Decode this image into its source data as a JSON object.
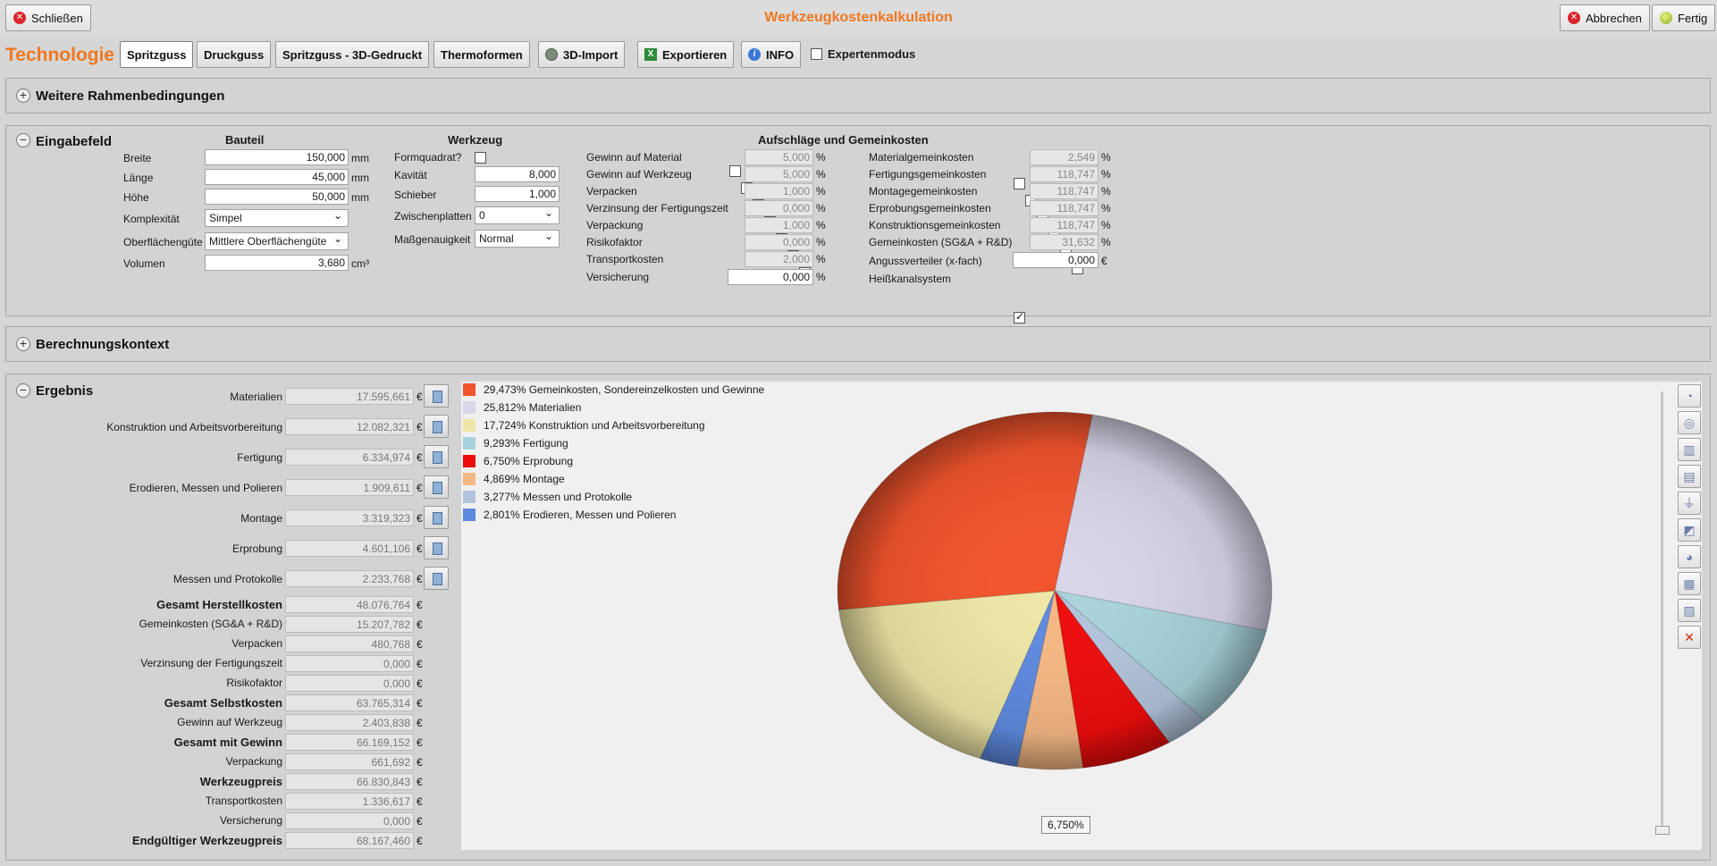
{
  "window": {
    "title": "Werkzeugkostenkalkulation",
    "close_label": "Schließen",
    "cancel_label": "Abbrechen",
    "done_label": "Fertig"
  },
  "toolbar": {
    "technology_label": "Technologie",
    "tabs": [
      "Spritzguss",
      "Druckguss",
      "Spritzguss - 3D-Gedruckt",
      "Thermoformen"
    ],
    "import_label": "3D-Import",
    "export_label": "Exportieren",
    "info_label": "INFO",
    "expert_label": "Expertenmodus"
  },
  "panels": {
    "rahmen": "Weitere Rahmenbedingungen",
    "eingabe": "Eingabefeld",
    "kontext": "Berechnungskontext",
    "ergebnis": "Ergebnis"
  },
  "bauteil": {
    "header": "Bauteil",
    "breite_label": "Breite",
    "breite": "150,000",
    "laenge_label": "Länge",
    "laenge": "45,000",
    "hoehe_label": "Höhe",
    "hoehe": "50,000",
    "mm": "mm",
    "komplex_label": "Komplexität",
    "komplex": "Simpel",
    "oberflaeche_label": "Oberflächengüte",
    "oberflaeche": "Mittlere Oberflächengüte",
    "volumen_label": "Volumen",
    "volumen": "3,680",
    "volumen_unit": "cm³"
  },
  "werkzeug": {
    "header": "Werkzeug",
    "formquadrat_label": "Formquadrat?",
    "kavitaet_label": "Kavität",
    "kavitaet": "8,000",
    "schieber_label": "Schieber",
    "schieber": "1,000",
    "zwischen_label": "Zwischenplatten",
    "zwischen": "0",
    "mass_label": "Maßgenauigkeit",
    "mass": "Normal"
  },
  "aufschlaege": {
    "header": "Aufschläge und Gemeinkosten",
    "left": [
      {
        "label": "Gewinn auf Material",
        "value": "5,000"
      },
      {
        "label": "Gewinn auf Werkzeug",
        "value": "5,000"
      },
      {
        "label": "Verpacken",
        "value": "1,000"
      },
      {
        "label": "Verzinsung der Fertigungszeit",
        "value": "0,000"
      },
      {
        "label": "Verpackung",
        "value": "1,000"
      },
      {
        "label": "Risikofaktor",
        "value": "0,000"
      },
      {
        "label": "Transportkosten",
        "value": "2,000"
      }
    ],
    "versicherung_label": "Versicherung",
    "versicherung": "0,000",
    "right": [
      {
        "label": "Materialgemeinkosten",
        "value": "2,549"
      },
      {
        "label": "Fertigungsgemeinkosten",
        "value": "118,747"
      },
      {
        "label": "Montagegemeinkosten",
        "value": "118,747"
      },
      {
        "label": "Erprobungsgemeinkosten",
        "value": "118,747"
      },
      {
        "label": "Konstruktionsgemeinkosten",
        "value": "118,747"
      },
      {
        "label": "Gemeinkosten (SG&A + R&D)",
        "value": "31,632"
      }
    ],
    "anguss_label": "Angussverteiler (x-fach)",
    "anguss": "0,000",
    "heiss_label": "Heißkanalsystem",
    "pct": "%",
    "eur": "€"
  },
  "ergebnis": {
    "items": [
      {
        "label": "Materialien",
        "value": "17.595,661"
      },
      {
        "label": "Konstruktion und Arbeitsvorbereitung",
        "value": "12.082,321"
      },
      {
        "label": "Fertigung",
        "value": "6.334,974"
      },
      {
        "label": "Erodieren, Messen und Polieren",
        "value": "1.909,611"
      },
      {
        "label": "Montage",
        "value": "3.319,323"
      },
      {
        "label": "Erprobung",
        "value": "4.601,106"
      },
      {
        "label": "Messen und Protokolle",
        "value": "2.233,768"
      }
    ],
    "totals": [
      {
        "label": "Gesamt Herstellkosten",
        "value": "48.076,764",
        "bold": true
      },
      {
        "label": "Gemeinkosten (SG&A + R&D)",
        "value": "15.207,782",
        "bold": false
      },
      {
        "label": "Verpacken",
        "value": "480,768",
        "bold": false
      },
      {
        "label": "Verzinsung der Fertigungszeit",
        "value": "0,000",
        "bold": false
      },
      {
        "label": "Risikofaktor",
        "value": "0,000",
        "bold": false
      },
      {
        "label": "Gesamt Selbstkosten",
        "value": "63.765,314",
        "bold": true
      },
      {
        "label": "Gewinn auf Werkzeug",
        "value": "2.403,838",
        "bold": false
      },
      {
        "label": "Gesamt mit Gewinn",
        "value": "66.169,152",
        "bold": true
      },
      {
        "label": "Verpackung",
        "value": "661,692",
        "bold": false
      },
      {
        "label": "Werkzeugpreis",
        "value": "66.830,843",
        "bold": true
      },
      {
        "label": "Transportkosten",
        "value": "1.336,617",
        "bold": false
      },
      {
        "label": "Versicherung",
        "value": "0,000",
        "bold": false
      },
      {
        "label": "Endgültiger Werkzeugpreis",
        "value": "68.167,460",
        "bold": true
      }
    ],
    "currency": "€"
  },
  "chart_data": {
    "type": "pie",
    "series": [
      {
        "label": "29,473% Gemeinkosten, Sondereinzelkosten und Gewinne",
        "value": 29.473,
        "color": "#f2542d"
      },
      {
        "label": "25,812% Materialien",
        "value": 25.812,
        "color": "#d8d6e8"
      },
      {
        "label": "17,724% Konstruktion und Arbeitsvorbereitung",
        "value": 17.724,
        "color": "#eee6a6"
      },
      {
        "label": "9,293% Fertigung",
        "value": 9.293,
        "color": "#a9d3dc"
      },
      {
        "label": "6,750% Erprobung",
        "value": 6.75,
        "color": "#ee0c0c"
      },
      {
        "label": "4,869% Montage",
        "value": 4.869,
        "color": "#f5b884"
      },
      {
        "label": "3,277% Messen und Protokolle",
        "value": 3.277,
        "color": "#b2c4dc"
      },
      {
        "label": "2,801% Erodieren, Messen und Polieren",
        "value": 2.801,
        "color": "#5e8ae0"
      }
    ],
    "pie_order": [
      1,
      3,
      6,
      4,
      5,
      7,
      2,
      0
    ],
    "hover_label": "6,750%"
  },
  "side_icons": [
    "pie-icon",
    "donut-icon",
    "bar-icon",
    "stacked-bar-icon",
    "funnel-icon",
    "area-icon",
    "pie-2d-icon",
    "bar-2d-icon",
    "stacked-2d-icon",
    "clear-chart-icon"
  ]
}
